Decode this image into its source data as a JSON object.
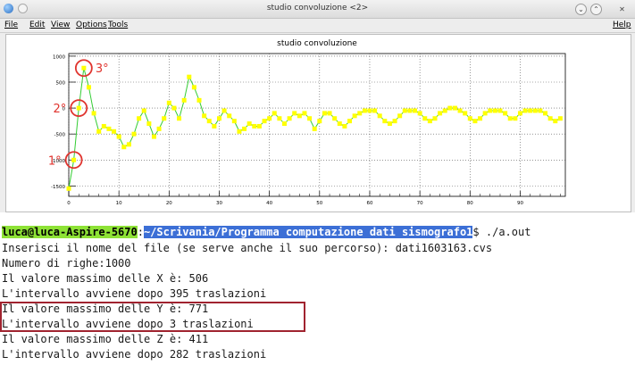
{
  "window": {
    "title": "studio convoluzione <2>",
    "icons": {
      "app": "root-app-icon",
      "minimize": "minimize-icon",
      "maximize": "maximize-icon",
      "close": "close-icon"
    }
  },
  "menubar": {
    "items": [
      "File",
      "Edit",
      "View",
      "Options",
      "Tools"
    ],
    "help": "Help"
  },
  "chart_data": {
    "type": "line",
    "title": "studio convoluzione",
    "xlabel": "",
    "ylabel": "",
    "xlim": [
      0,
      99
    ],
    "ylim": [
      -1700,
      1050
    ],
    "x_ticks": [
      0,
      10,
      20,
      30,
      40,
      50,
      60,
      70,
      80,
      90
    ],
    "y_ticks": [
      -1500,
      -1000,
      -500,
      0,
      500,
      1000
    ],
    "grid": true,
    "line_color": "#33cc33",
    "marker_color": "#ffff00",
    "x": [
      0,
      1,
      2,
      3,
      4,
      5,
      6,
      7,
      8,
      9,
      10,
      11,
      12,
      13,
      14,
      15,
      16,
      17,
      18,
      19,
      20,
      21,
      22,
      23,
      24,
      25,
      26,
      27,
      28,
      29,
      30,
      31,
      32,
      33,
      34,
      35,
      36,
      37,
      38,
      39,
      40,
      41,
      42,
      43,
      44,
      45,
      46,
      47,
      48,
      49,
      50,
      51,
      52,
      53,
      54,
      55,
      56,
      57,
      58,
      59,
      60,
      61,
      62,
      63,
      64,
      65,
      66,
      67,
      68,
      69,
      70,
      71,
      72,
      73,
      74,
      75,
      76,
      77,
      78,
      79,
      80,
      81,
      82,
      83,
      84,
      85,
      86,
      87,
      88,
      89,
      90,
      91,
      92,
      93,
      94,
      95,
      96,
      97,
      98
    ],
    "y": [
      -1550,
      -1000,
      0,
      771,
      400,
      -100,
      -450,
      -350,
      -400,
      -450,
      -550,
      -750,
      -700,
      -500,
      -200,
      -50,
      -300,
      -550,
      -400,
      -200,
      100,
      0,
      -200,
      150,
      600,
      400,
      150,
      -150,
      -250,
      -350,
      -200,
      -50,
      -150,
      -250,
      -450,
      -400,
      -300,
      -350,
      -350,
      -250,
      -200,
      -100,
      -200,
      -300,
      -200,
      -100,
      -150,
      -100,
      -200,
      -400,
      -250,
      -100,
      -100,
      -200,
      -300,
      -350,
      -250,
      -150,
      -100,
      -50,
      -50,
      -50,
      -150,
      -250,
      -300,
      -250,
      -150,
      -50,
      -50,
      -50,
      -100,
      -200,
      -250,
      -200,
      -100,
      -50,
      0,
      0,
      -50,
      -100,
      -200,
      -250,
      -200,
      -100,
      -50,
      -50,
      -50,
      -100,
      -200,
      -200,
      -100,
      -50,
      -50,
      -50,
      -50,
      -100,
      -200,
      -250,
      -200
    ],
    "annotations": [
      {
        "label": "3°",
        "x": 3,
        "y": 771
      },
      {
        "label": "2°",
        "x": 2,
        "y": 0
      },
      {
        "label": "1°",
        "x": 1,
        "y": -1000
      }
    ],
    "annotation_color": "#e0342e"
  },
  "terminal": {
    "prompt_user": "luca@luca-Aspire-5670",
    "prompt_sep": ":",
    "prompt_path": "~/Scrivania/Programma computazione dati sismografo1",
    "prompt_cmd": "$ ./a.out",
    "lines": [
      "Inserisci il nome del file (se serve anche il suo percorso): dati1603163.cvs",
      "Numero di righe:1000",
      "Il valore massimo delle X è: 506",
      "L'intervallo avviene dopo 395 traslazioni",
      "Il valore massimo delle Y è: 771",
      "L'intervallo avviene dopo 3 traslazioni",
      "Il valore massimo delle Z è: 411",
      "L'intervallo avviene dopo 282 traslazioni"
    ],
    "highlight_color": "#a0232f"
  }
}
